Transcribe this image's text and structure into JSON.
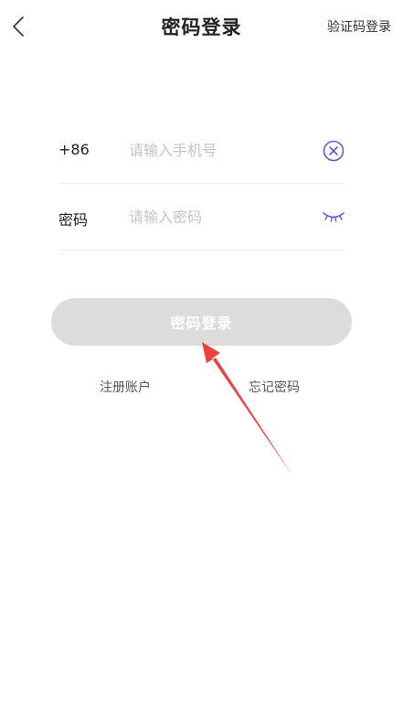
{
  "header": {
    "back_icon": "chevron-left-icon",
    "title": "密码登录",
    "switch_link": "验证码登录"
  },
  "form": {
    "phone": {
      "prefix": "+86",
      "placeholder": "请输入手机号",
      "value": "",
      "clear_icon": "clear-circle-x-icon"
    },
    "password": {
      "label": "密码",
      "placeholder": "请输入密码",
      "value": "",
      "visibility_icon": "eye-closed-icon"
    }
  },
  "login_button": {
    "label": "密码登录",
    "enabled": false
  },
  "links": {
    "register": "注册账户",
    "forgot": "忘记密码"
  },
  "colors": {
    "accent": "#5b5fd0",
    "button_disabled": "#dcdcdc",
    "annotation": "#f0413d"
  }
}
